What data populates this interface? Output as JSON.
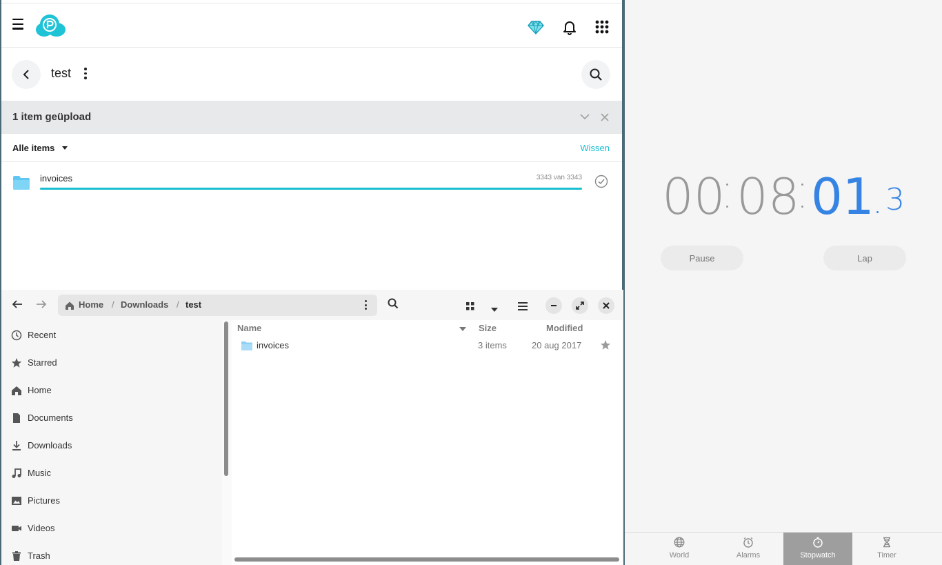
{
  "pcloud": {
    "folder_name": "test",
    "upload_title": "1 item geüpload",
    "filter_label": "Alle items",
    "clear_label": "Wissen",
    "upload_item": {
      "name": "invoices",
      "count": "3343 van 3343",
      "progress": 1.0
    },
    "colors": {
      "accent": "#17bed0",
      "folder": "#5ec8f2"
    }
  },
  "files": {
    "breadcrumb": {
      "home": "Home",
      "downloads": "Downloads",
      "current": "test"
    },
    "sidebar": {
      "items": [
        {
          "label": "Recent",
          "icon": "clock-icon"
        },
        {
          "label": "Starred",
          "icon": "star-icon"
        },
        {
          "label": "Home",
          "icon": "home-icon"
        },
        {
          "label": "Documents",
          "icon": "document-icon"
        },
        {
          "label": "Downloads",
          "icon": "download-icon"
        },
        {
          "label": "Music",
          "icon": "music-icon"
        },
        {
          "label": "Pictures",
          "icon": "picture-icon"
        },
        {
          "label": "Videos",
          "icon": "video-icon"
        },
        {
          "label": "Trash",
          "icon": "trash-icon"
        }
      ]
    },
    "columns": {
      "name": "Name",
      "size": "Size",
      "modified": "Modified"
    },
    "rows": [
      {
        "name": "invoices",
        "size": "3 items",
        "modified": "20 aug 2017"
      }
    ]
  },
  "clocks": {
    "stopwatch": {
      "h": "00",
      "m": "08",
      "s": "01",
      "tenths": "3"
    },
    "pause_label": "Pause",
    "lap_label": "Lap",
    "tabs": [
      {
        "label": "World",
        "icon": "globe-icon"
      },
      {
        "label": "Alarms",
        "icon": "alarm-icon"
      },
      {
        "label": "Stopwatch",
        "icon": "stopwatch-icon",
        "active": true
      },
      {
        "label": "Timer",
        "icon": "hourglass-icon"
      }
    ],
    "colors": {
      "active_digits": "#3584e4",
      "inactive_digits": "#999999"
    }
  }
}
